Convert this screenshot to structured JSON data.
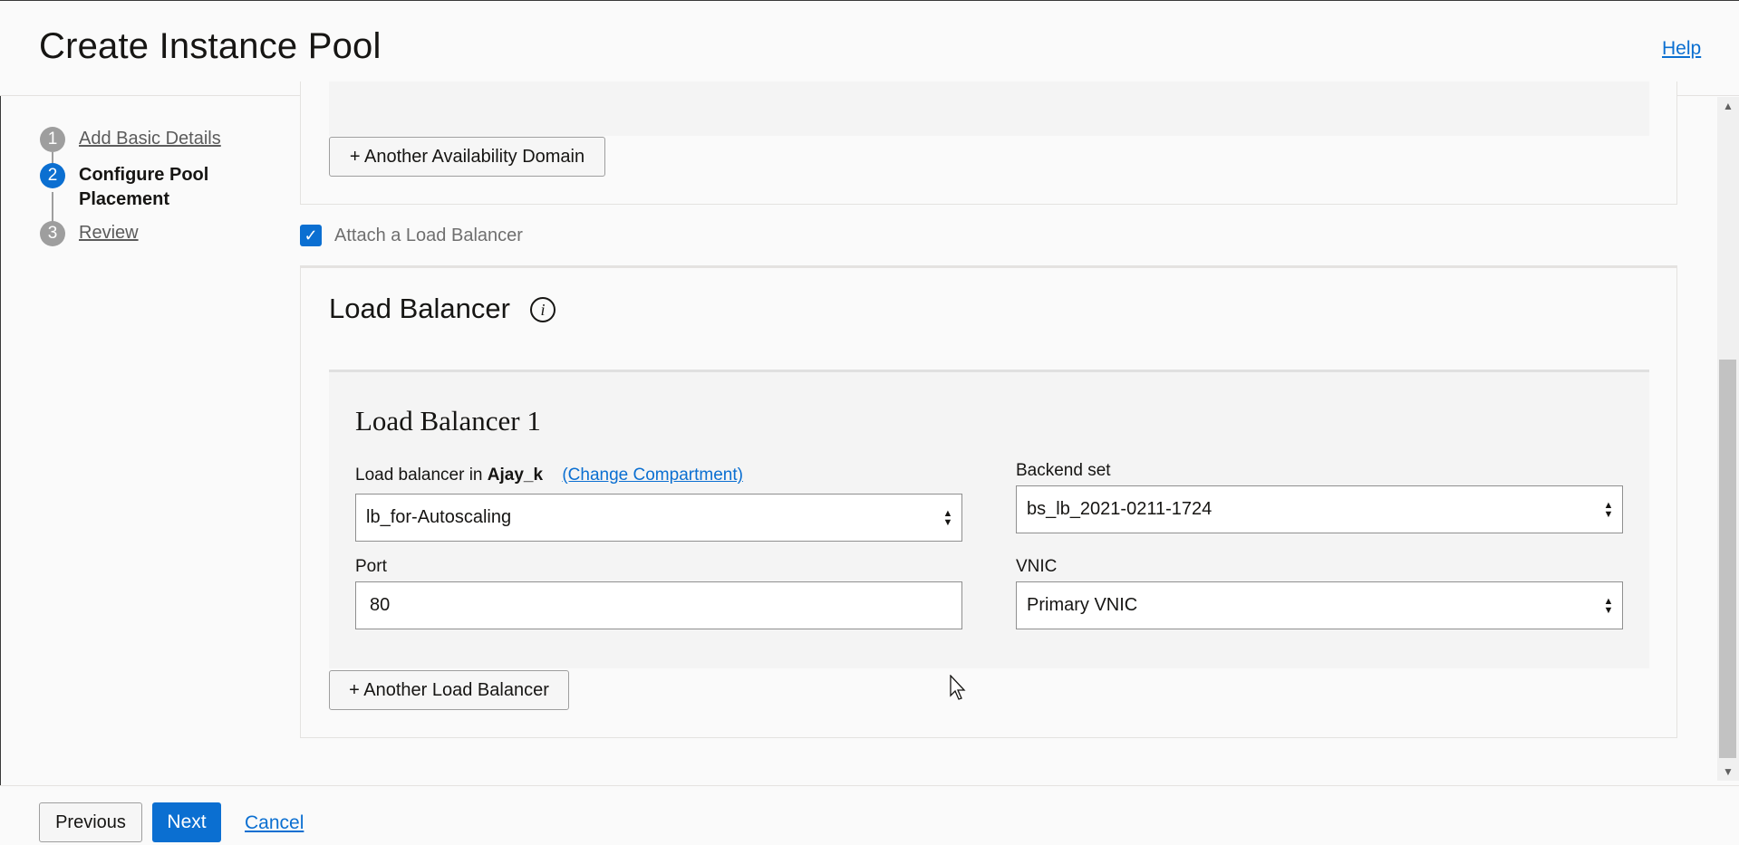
{
  "header": {
    "title": "Create Instance Pool",
    "help_label": "Help"
  },
  "steps": [
    {
      "number": "1",
      "label": "Add Basic Details",
      "state": "link"
    },
    {
      "number": "2",
      "label": "Configure Pool Placement",
      "state": "active"
    },
    {
      "number": "3",
      "label": "Review",
      "state": "link"
    }
  ],
  "availability_domain": {
    "add_button_label": "+ Another Availability Domain"
  },
  "attach_lb": {
    "label": "Attach a Load Balancer",
    "checked": true
  },
  "load_balancer_section": {
    "title": "Load Balancer",
    "card": {
      "title": "Load Balancer 1",
      "lb_field": {
        "label_prefix": "Load balancer in",
        "compartment": "Ajay_k",
        "change_link": "(Change Compartment)",
        "value": "lb_for-Autoscaling"
      },
      "backend_set": {
        "label": "Backend set",
        "value": "bs_lb_2021-0211-1724"
      },
      "port": {
        "label": "Port",
        "value": "80"
      },
      "vnic": {
        "label": "VNIC",
        "value": "Primary VNIC"
      }
    },
    "add_button_label": "+ Another Load Balancer"
  },
  "footer": {
    "previous_label": "Previous",
    "next_label": "Next",
    "cancel_label": "Cancel"
  },
  "colors": {
    "accent": "#0b6fd1",
    "step_inactive": "#9e9e9e"
  }
}
